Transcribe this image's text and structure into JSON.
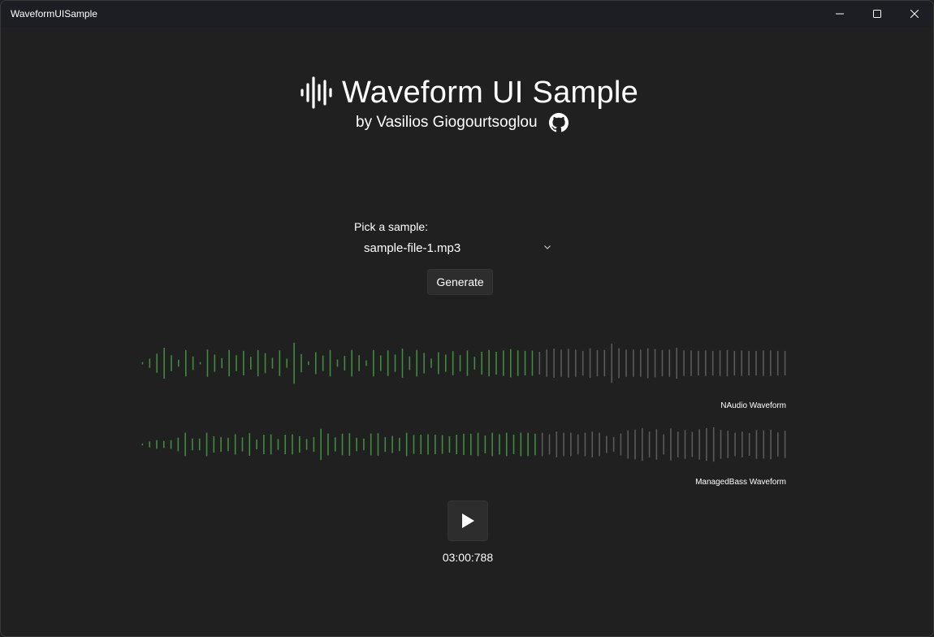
{
  "window": {
    "title": "WaveformUISample",
    "controls": {
      "minimize_icon": "minimize-icon",
      "maximize_icon": "maximize-icon",
      "close_icon": "close-icon"
    }
  },
  "header": {
    "title": "Waveform UI Sample",
    "author": "by Vasilios Giogourtsoglou",
    "logo_icon": "waveform-icon",
    "link_icon": "github-icon"
  },
  "picker": {
    "label": "Pick a sample:",
    "selected": "sample-file-1.mp3"
  },
  "generate_label": "Generate",
  "waveforms": [
    {
      "label": "NAudio Waveform",
      "played_color": "#3f8c3f",
      "unplayed_color": "#5a5a5a",
      "progress": 0.61,
      "amplitudes": [
        0.05,
        0.2,
        0.42,
        0.68,
        0.35,
        0.15,
        0.58,
        0.3,
        0.05,
        0.6,
        0.38,
        0.22,
        0.58,
        0.35,
        0.54,
        0.28,
        0.58,
        0.44,
        0.24,
        0.56,
        0.2,
        0.9,
        0.4,
        0.08,
        0.48,
        0.34,
        0.58,
        0.16,
        0.32,
        0.58,
        0.35,
        0.12,
        0.58,
        0.34,
        0.56,
        0.38,
        0.64,
        0.3,
        0.58,
        0.45,
        0.2,
        0.48,
        0.38,
        0.53,
        0.36,
        0.56,
        0.28,
        0.5,
        0.58,
        0.5,
        0.56,
        0.62,
        0.56,
        0.54,
        0.55,
        0.5,
        0.6,
        0.64,
        0.6,
        0.63,
        0.6,
        0.54,
        0.65,
        0.58,
        0.58,
        0.86,
        0.66,
        0.6,
        0.6,
        0.6,
        0.66,
        0.62,
        0.58,
        0.6,
        0.68,
        0.56,
        0.56,
        0.54,
        0.56,
        0.54,
        0.56,
        0.58,
        0.54,
        0.56,
        0.54,
        0.54,
        0.56,
        0.56,
        0.54,
        0.54
      ]
    },
    {
      "label": "ManagedBass Waveform",
      "played_color": "#3f8c3f",
      "unplayed_color": "#5a5a5a",
      "progress": 0.62,
      "amplitudes": [
        0.05,
        0.15,
        0.22,
        0.18,
        0.22,
        0.35,
        0.6,
        0.3,
        0.3,
        0.6,
        0.42,
        0.38,
        0.34,
        0.52,
        0.36,
        0.58,
        0.25,
        0.5,
        0.52,
        0.28,
        0.5,
        0.52,
        0.42,
        0.28,
        0.38,
        0.8,
        0.56,
        0.36,
        0.55,
        0.58,
        0.34,
        0.3,
        0.56,
        0.58,
        0.38,
        0.44,
        0.34,
        0.6,
        0.48,
        0.5,
        0.52,
        0.5,
        0.48,
        0.42,
        0.5,
        0.54,
        0.55,
        0.6,
        0.46,
        0.6,
        0.52,
        0.6,
        0.5,
        0.6,
        0.6,
        0.55,
        0.6,
        0.52,
        0.66,
        0.6,
        0.6,
        0.52,
        0.6,
        0.66,
        0.6,
        0.44,
        0.38,
        0.56,
        0.72,
        0.76,
        0.84,
        0.66,
        0.78,
        0.52,
        0.82,
        0.66,
        0.74,
        0.64,
        0.78,
        0.84,
        0.88,
        0.74,
        0.7,
        0.6,
        0.66,
        0.58,
        0.74,
        0.72,
        0.76,
        0.62,
        0.7
      ]
    }
  ],
  "player": {
    "play_icon": "play-icon",
    "time": "03:00:788"
  }
}
